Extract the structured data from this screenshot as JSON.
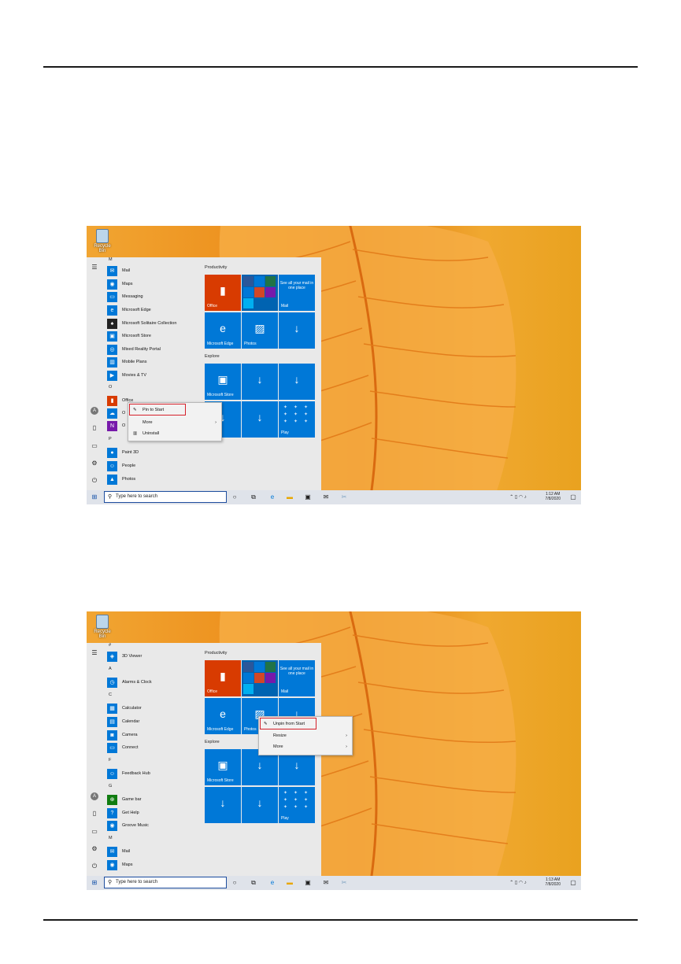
{
  "screens": [
    {
      "desktop_icon": "Recycle Bin",
      "apps": [
        {
          "type": "header",
          "label": "M"
        },
        {
          "label": "Mail"
        },
        {
          "label": "Maps"
        },
        {
          "label": "Messaging"
        },
        {
          "label": "Microsoft Edge"
        },
        {
          "label": "Microsoft Solitaire Collection"
        },
        {
          "label": "Microsoft Store"
        },
        {
          "label": "Mixed Reality Portal"
        },
        {
          "label": "Mobile Plans"
        },
        {
          "label": "Movies & TV"
        },
        {
          "type": "header",
          "label": "O"
        },
        {
          "label": "Office"
        },
        {
          "label": "O"
        },
        {
          "label": "O"
        },
        {
          "type": "header",
          "label": "P"
        },
        {
          "label": "Paint 3D"
        },
        {
          "label": "People"
        },
        {
          "label": "Photos"
        }
      ],
      "context_menu": {
        "items": [
          "Pin to Start",
          "More",
          "Uninstall"
        ]
      }
    },
    {
      "desktop_icon": "Recycle Bin",
      "apps": [
        {
          "type": "header",
          "label": "#"
        },
        {
          "label": "3D Viewer"
        },
        {
          "type": "header",
          "label": "A"
        },
        {
          "label": "Alarms & Clock"
        },
        {
          "type": "header",
          "label": "C"
        },
        {
          "label": "Calculator"
        },
        {
          "label": "Calendar"
        },
        {
          "label": "Camera"
        },
        {
          "label": "Connect"
        },
        {
          "type": "header",
          "label": "F"
        },
        {
          "label": "Feedback Hub"
        },
        {
          "type": "header",
          "label": "G"
        },
        {
          "label": "Game bar"
        },
        {
          "label": "Get Help"
        },
        {
          "label": "Groove Music"
        },
        {
          "type": "header",
          "label": "M"
        },
        {
          "label": "Mail"
        },
        {
          "label": "Maps"
        }
      ],
      "context_menu": {
        "items": [
          "Unpin from Start",
          "Resize",
          "More"
        ]
      }
    }
  ],
  "tiles": {
    "productivity_label": "Productivity",
    "explore_label": "Explore",
    "office": "Office",
    "mail_text": "See all your mail in one place",
    "mail": "Mail",
    "edge": "Microsoft Edge",
    "photos": "Photos",
    "store": "Microsoft Store",
    "play": "Play"
  },
  "taskbar": {
    "search_placeholder": "Type here to search",
    "time": "1:12 AM",
    "date": "7/8/2020",
    "time2": "1:13 AM",
    "date2": "7/8/2020"
  },
  "colors": {
    "accent": "#0078d7",
    "office": "#d83b01",
    "highlight": "#d5202a"
  }
}
